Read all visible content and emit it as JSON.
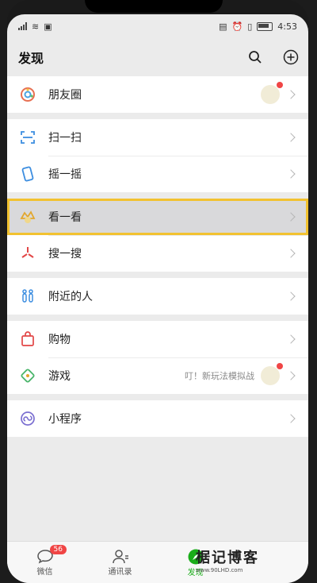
{
  "status": {
    "time": "4:53"
  },
  "header": {
    "title": "发现"
  },
  "groups": [
    [
      {
        "key": "moments",
        "label": "朋友圈"
      }
    ],
    [
      {
        "key": "scan",
        "label": "扫一扫"
      },
      {
        "key": "shake",
        "label": "摇一摇"
      }
    ],
    [
      {
        "key": "topstories",
        "label": "看一看"
      },
      {
        "key": "search",
        "label": "搜一搜"
      }
    ],
    [
      {
        "key": "nearby",
        "label": "附近的人"
      }
    ],
    [
      {
        "key": "shop",
        "label": "购物"
      },
      {
        "key": "games",
        "label": "游戏",
        "extra": "叮！新玩法模拟战"
      }
    ],
    [
      {
        "key": "miniprogram",
        "label": "小程序"
      }
    ]
  ],
  "tabbar": [
    {
      "label": "微信",
      "badge": "56"
    },
    {
      "label": "通讯录"
    },
    {
      "label": "发现"
    }
  ],
  "watermark": {
    "title": "椐记博客",
    "url": "www.90LHD.com"
  },
  "colors": {
    "accent": "#1aad19",
    "badge": "#f04545",
    "highlight": "#f2c230"
  }
}
